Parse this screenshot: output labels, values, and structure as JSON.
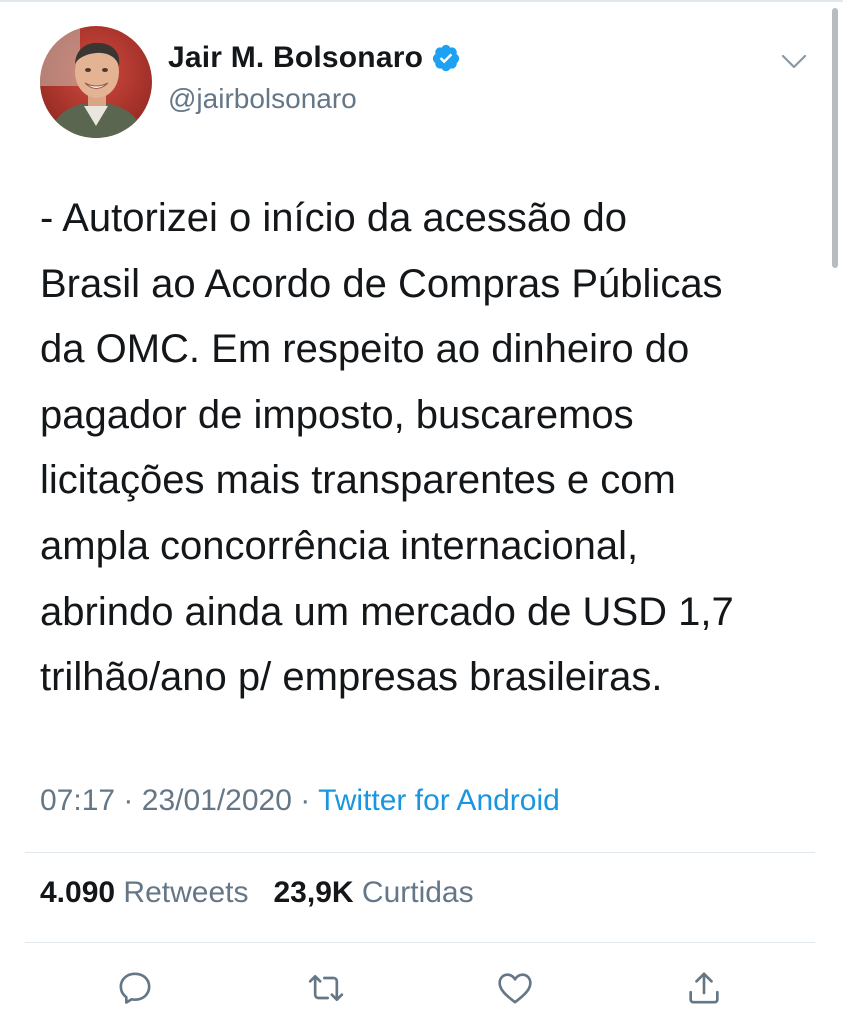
{
  "tweet": {
    "author": {
      "display_name": "Jair M. Bolsonaro",
      "handle": "@jairbolsonaro",
      "verified": true,
      "avatar_icon": "profile-photo"
    },
    "text": "- Autorizei o início da acessão do\nBrasil ao Acordo de Compras Públicas\nda OMC. Em respeito ao dinheiro do\npagador de imposto, buscaremos\nlicitações mais transparentes e com\nampla concorrência internacional,\nabrindo ainda um mercado de USD 1,7\ntrilhão/ano p/ empresas brasileiras.",
    "time": "07:17",
    "date": "23/01/2020",
    "separator": "·",
    "source": "Twitter for Android",
    "stats": {
      "retweets_count": "4.090",
      "retweets_label": "Retweets",
      "likes_count": "23,9K",
      "likes_label": "Curtidas"
    }
  },
  "actions": [
    {
      "name": "reply",
      "icon": "reply-icon"
    },
    {
      "name": "retweet",
      "icon": "retweet-icon"
    },
    {
      "name": "like",
      "icon": "heart-icon"
    },
    {
      "name": "share",
      "icon": "share-icon"
    }
  ],
  "colors": {
    "text": "#14171a",
    "secondary": "#657786",
    "link": "#1b95e0",
    "verified": "#1da1f2",
    "divider": "#e1e8ed"
  }
}
